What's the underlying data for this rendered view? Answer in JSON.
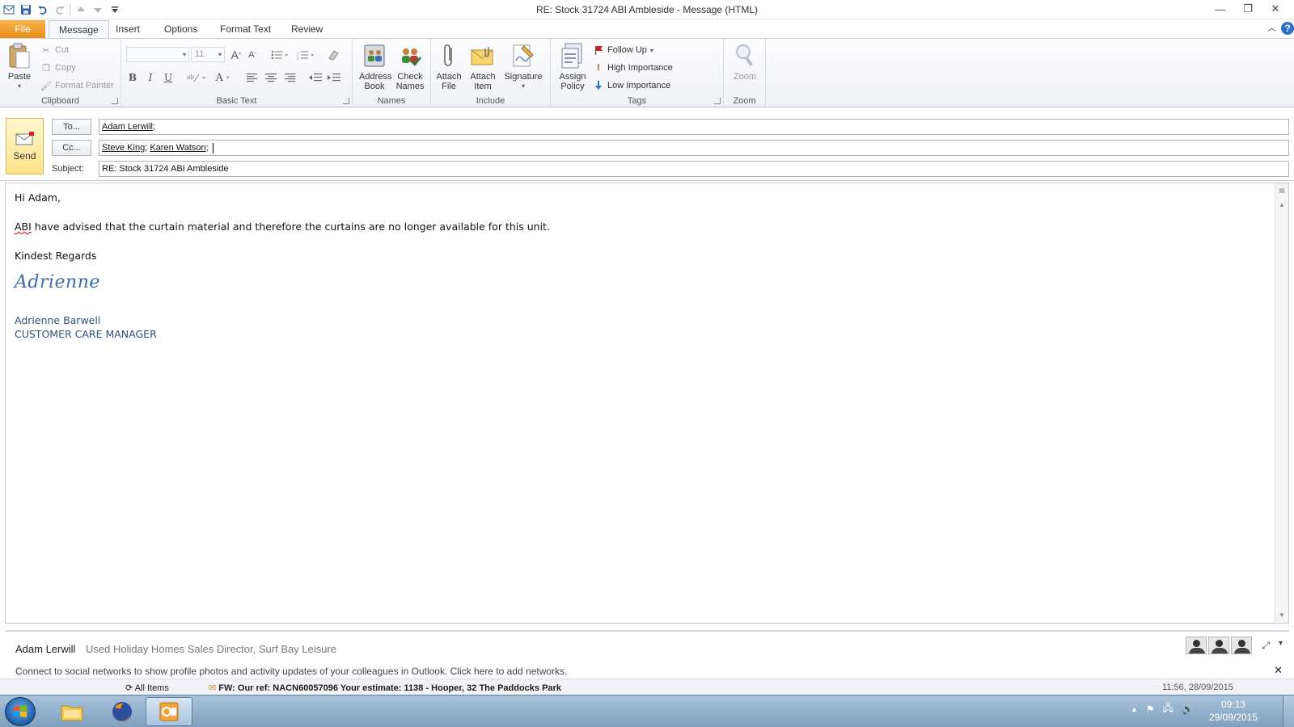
{
  "window": {
    "title": "RE: Stock 31724 ABI Ambleside  -  Message (HTML)",
    "minimize": "—",
    "restore": "❐",
    "close": "✕"
  },
  "tabs": [
    {
      "label": "File"
    },
    {
      "label": "Message"
    },
    {
      "label": "Insert"
    },
    {
      "label": "Options"
    },
    {
      "label": "Format Text"
    },
    {
      "label": "Review"
    }
  ],
  "help_label": "?",
  "ribbon": {
    "clipboard": {
      "label": "Clipboard",
      "paste": "Paste",
      "cut": "Cut",
      "copy": "Copy",
      "format_painter": "Format Painter"
    },
    "basic_text": {
      "label": "Basic Text",
      "font_size": "11",
      "bold": "B",
      "italic": "I",
      "underline": "U",
      "grow": "A",
      "shrink": "A",
      "font_color": "A"
    },
    "names": {
      "label": "Names",
      "address_book": "Address Book",
      "check_names": "Check Names"
    },
    "include": {
      "label": "Include",
      "attach_file": "Attach File",
      "attach_item": "Attach Item",
      "signature": "Signature"
    },
    "tags": {
      "label": "Tags",
      "assign_policy": "Assign Policy",
      "follow_up": "Follow Up",
      "high_importance": "High Importance",
      "low_importance": "Low Importance"
    },
    "zoom": {
      "label": "Zoom",
      "zoom": "Zoom"
    }
  },
  "compose": {
    "send": "Send",
    "to_button": "To...",
    "cc_button": "Cc...",
    "subject_label": "Subject:",
    "to": [
      "Adam Lerwill"
    ],
    "cc": [
      "Steve King",
      "Karen Watson"
    ],
    "subject": "RE: Stock 31724 ABI Ambleside"
  },
  "body": {
    "greeting": "Hi Adam,",
    "line1_flagged": "ABI",
    "line1_rest": " have advised that the curtain material and therefore the curtains are no longer available for this unit.",
    "closing": "Kindest Regards",
    "signature_script": "Adrienne",
    "sig_name": "Adrienne Barwell",
    "sig_title": "CUSTOMER CARE MANAGER"
  },
  "people_pane": {
    "name": "Adam Lerwill",
    "title": "Used Holiday Homes Sales Director, Surf Bay Leisure",
    "social": "Connect to social networks to show profile photos and activity updates of your colleagues in Outlook. Click here to add networks."
  },
  "underlying": {
    "folder": "All Items",
    "message": "FW: Our ref: NACN60057096 Your estimate: 1138 - Hooper, 32 The Paddocks Park",
    "time": "11:56, 28/09/2015"
  },
  "taskbar": {
    "time": "09:13",
    "date": "29/09/2015"
  },
  "colors": {
    "file_tab": "#e88b12",
    "send_button": "#fde28a",
    "signature": "#3d6aa8",
    "taskbar": "#7e9fbd"
  }
}
